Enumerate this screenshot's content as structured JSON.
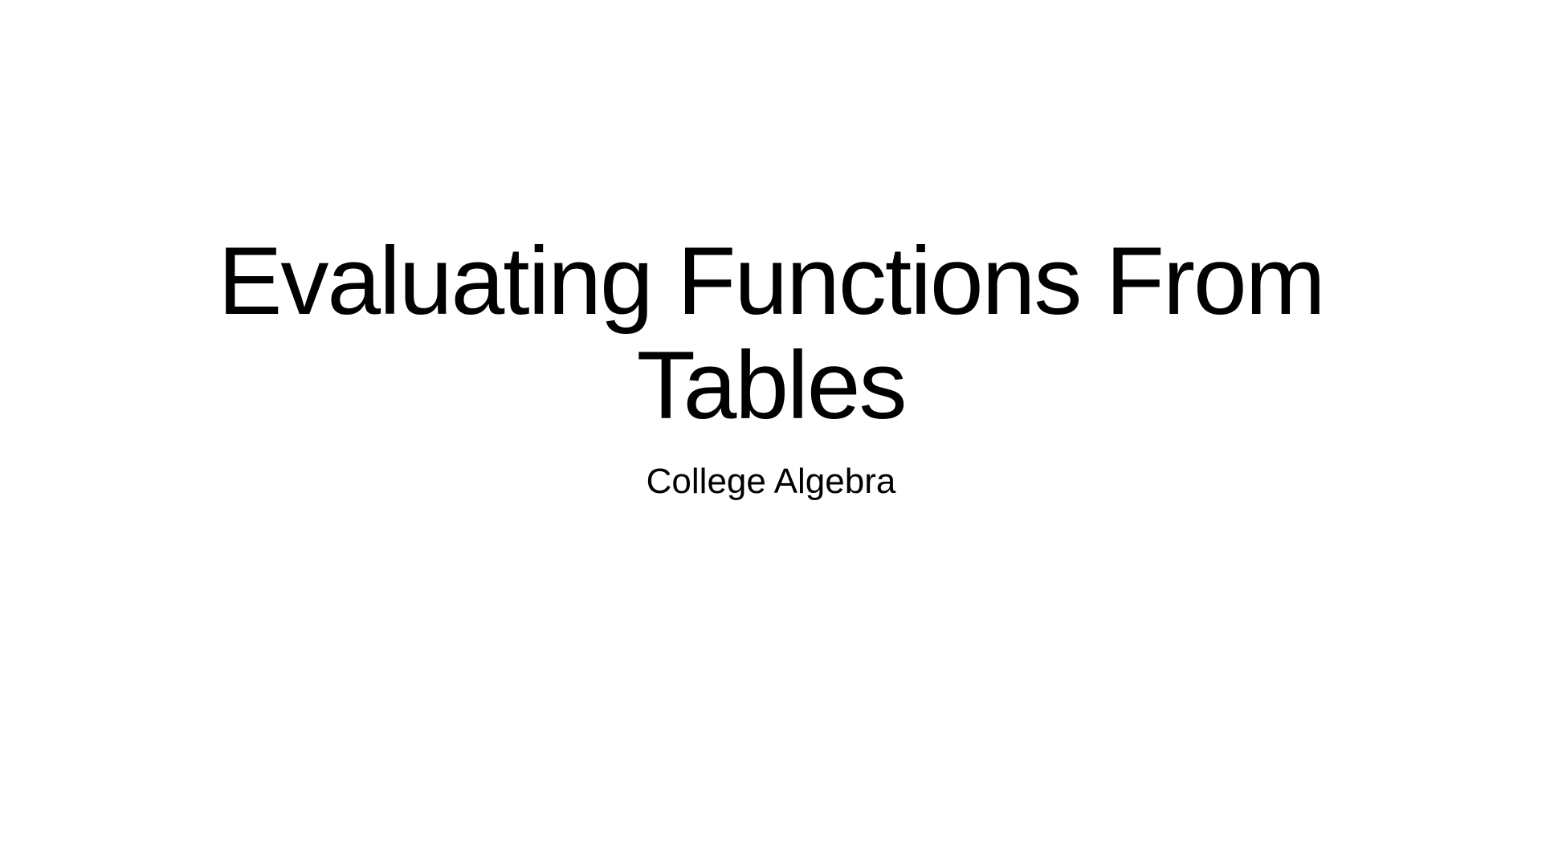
{
  "slide": {
    "title": "Evaluating Functions From Tables",
    "subtitle": "College Algebra",
    "background_color": "#ffffff",
    "text_color": "#000000"
  }
}
